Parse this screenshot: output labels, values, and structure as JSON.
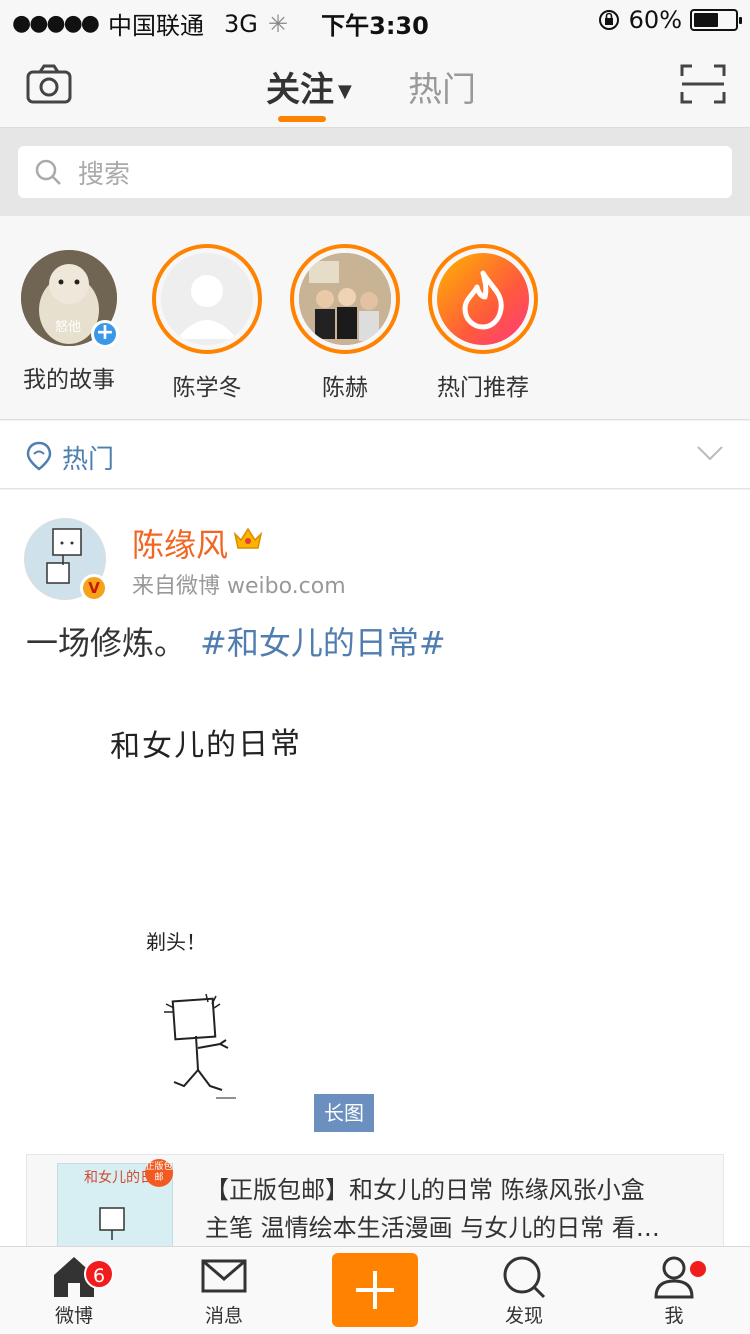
{
  "status_bar": {
    "carrier": "中国联通",
    "network": "3G",
    "time": "下午3:30",
    "battery": "60%",
    "battery_level": 0.6
  },
  "nav": {
    "tab_follow": "关注",
    "tab_hot": "热门"
  },
  "search": {
    "placeholder": "搜索"
  },
  "stories": [
    {
      "label": "我的故事",
      "avatar_text": "怒他"
    },
    {
      "label": "陈学冬"
    },
    {
      "label": "陈赫"
    },
    {
      "label": "热门推荐"
    }
  ],
  "hot_section": {
    "title": "热门"
  },
  "post": {
    "author": "陈缘风",
    "source": "来自微博 weibo.com",
    "text": "一场修炼。",
    "hashtag": "#和女儿的日常#",
    "image_title": "和女儿的日常",
    "image_caption": "剃头！",
    "long_image_badge": "长图",
    "card": {
      "badge": "正版包邮",
      "cover_title": "和女儿的日常",
      "line1": "【正版包邮】和女儿的日常 陈缘风张小盒",
      "line2": "主笔 温情绘本生活漫画 与女儿的日常 看…"
    }
  },
  "tabbar": [
    {
      "label": "微博",
      "badge": "6"
    },
    {
      "label": "消息"
    },
    {
      "label": "发现"
    },
    {
      "label": "我"
    }
  ],
  "colors": {
    "accent": "#ff8200",
    "link": "#507daf",
    "badge": "#f31c1c"
  }
}
